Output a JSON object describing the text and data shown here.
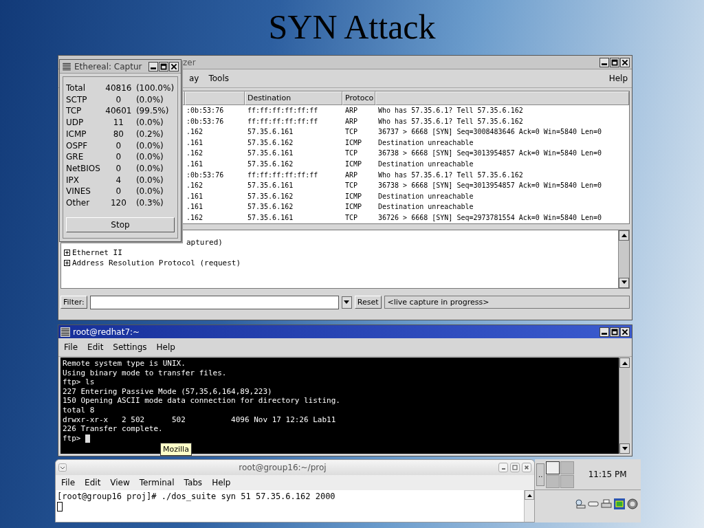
{
  "slide": {
    "title": "SYN Attack"
  },
  "analyzer": {
    "title": "zer",
    "menu": [
      {
        "label": "ay"
      },
      {
        "label": "Tools"
      },
      {
        "label": "Help"
      }
    ],
    "columns": [
      "",
      "",
      "Destination",
      "Protoco",
      ""
    ],
    "rows": [
      {
        "source": ":0b:53:76",
        "destination": "ff:ff:ff:ff:ff:ff",
        "protocol": "ARP",
        "info": "Who has 57.35.6.1?  Tell 57.35.6.162"
      },
      {
        "source": ":0b:53:76",
        "destination": "ff:ff:ff:ff:ff:ff",
        "protocol": "ARP",
        "info": "Who has 57.35.6.1?  Tell 57.35.6.162"
      },
      {
        "source": ".162",
        "destination": "57.35.6.161",
        "protocol": "TCP",
        "info": "36737 > 6668 [SYN] Seq=3008483646 Ack=0 Win=5840 Len=0"
      },
      {
        "source": ".161",
        "destination": "57.35.6.162",
        "protocol": "ICMP",
        "info": "Destination unreachable"
      },
      {
        "source": ".162",
        "destination": "57.35.6.161",
        "protocol": "TCP",
        "info": "36738 > 6668 [SYN] Seq=3013954857 Ack=0 Win=5840 Len=0"
      },
      {
        "source": ".161",
        "destination": "57.35.6.162",
        "protocol": "ICMP",
        "info": "Destination unreachable"
      },
      {
        "source": ":0b:53:76",
        "destination": "ff:ff:ff:ff:ff:ff",
        "protocol": "ARP",
        "info": "Who has 57.35.6.1?  Tell 57.35.6.162"
      },
      {
        "source": ".162",
        "destination": "57.35.6.161",
        "protocol": "TCP",
        "info": "36738 > 6668 [SYN] Seq=3013954857 Ack=0 Win=5840 Len=0"
      },
      {
        "source": ".161",
        "destination": "57.35.6.162",
        "protocol": "ICMP",
        "info": "Destination unreachable"
      },
      {
        "source": ".161",
        "destination": "57.35.6.162",
        "protocol": "ICMP",
        "info": "Destination unreachable"
      },
      {
        "source": ".162",
        "destination": "57.35.6.161",
        "protocol": "TCP",
        "info": "36726 > 6668 [SYN] Seq=2973781554 Ack=0 Win=5840 Len=0"
      }
    ],
    "details": [
      {
        "text": "aptured)",
        "kind": "cut"
      },
      {
        "text": "Ethernet II",
        "kind": "node"
      },
      {
        "text": "Address Resolution Protocol (request)",
        "kind": "node"
      }
    ],
    "filter": {
      "label": "Filter:",
      "reset": "Reset",
      "status": "<live capture in progress>"
    }
  },
  "capture_dialog": {
    "title": "Ethereal: Captur",
    "stats": [
      {
        "protocol": "Total",
        "count": "40816",
        "percent": "(100.0%)"
      },
      {
        "protocol": "SCTP",
        "count": "0",
        "percent": "(0.0%)"
      },
      {
        "protocol": "TCP",
        "count": "40601",
        "percent": "(99.5%)"
      },
      {
        "protocol": "UDP",
        "count": "11",
        "percent": "(0.0%)"
      },
      {
        "protocol": "ICMP",
        "count": "80",
        "percent": "(0.2%)"
      },
      {
        "protocol": "OSPF",
        "count": "0",
        "percent": "(0.0%)"
      },
      {
        "protocol": "GRE",
        "count": "0",
        "percent": "(0.0%)"
      },
      {
        "protocol": "NetBIOS",
        "count": "0",
        "percent": "(0.0%)"
      },
      {
        "protocol": "IPX",
        "count": "4",
        "percent": "(0.0%)"
      },
      {
        "protocol": "VINES",
        "count": "0",
        "percent": "(0.0%)"
      },
      {
        "protocol": "Other",
        "count": "120",
        "percent": "(0.3%)"
      }
    ],
    "stop": "Stop"
  },
  "terminal": {
    "title": "root@redhat7:~",
    "menu": [
      "File",
      "Edit",
      "Settings",
      "Help"
    ],
    "lines": [
      "Remote system type is UNIX.",
      "Using binary mode to transfer files.",
      "ftp> ls",
      "227 Entering Passive Mode (57,35,6,164,89,223)",
      "150 Opening ASCII mode data connection for directory listing.",
      "total 8",
      "drwxr-xr-x   2 502      502          4096 Nov 17 12:26 Lab11",
      "226 Transfer complete."
    ],
    "prompt": "ftp> "
  },
  "tooltip": "Mozilla",
  "gnome_terminal": {
    "title": "root@group16:~/proj",
    "menu": [
      "File",
      "Edit",
      "View",
      "Terminal",
      "Tabs",
      "Help"
    ],
    "lines": [
      "[root@group16 proj]# ./dos_suite syn 51 57.35.6.162 2000"
    ]
  },
  "panel": {
    "task": "..",
    "clock": "11:15 PM"
  }
}
